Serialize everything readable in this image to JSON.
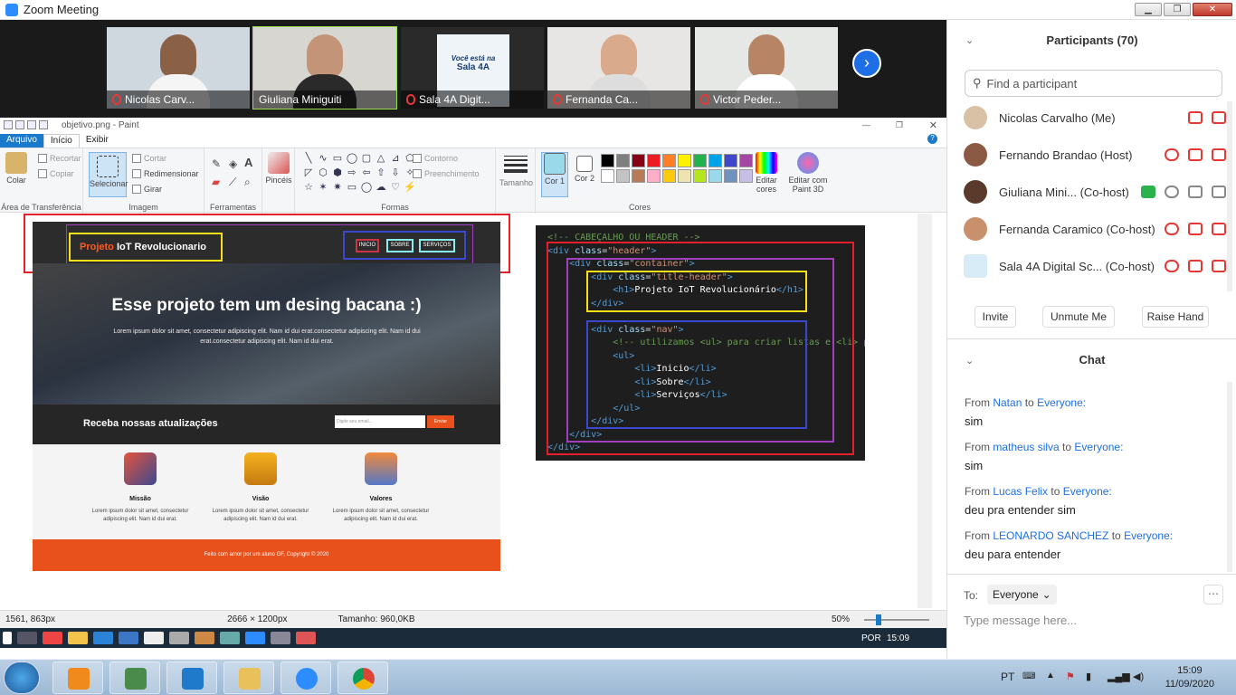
{
  "window": {
    "title": "Zoom Meeting"
  },
  "gallery": {
    "tiles": [
      {
        "name": "Nicolas Carv...",
        "muted": true
      },
      {
        "name": "Giuliana Miniguiti",
        "muted": false
      },
      {
        "name": "Sala 4A Digit...",
        "muted": true,
        "banner_line1": "Você está na",
        "banner_line2": "Sala 4A"
      },
      {
        "name": "Fernanda Ca...",
        "muted": true
      },
      {
        "name": "Victor Peder...",
        "muted": true
      }
    ]
  },
  "paint": {
    "title": "objetivo.png - Paint",
    "tabs": [
      "Arquivo",
      "Início",
      "Exibir"
    ],
    "ribbon": {
      "clipboard": {
        "paste": "Colar",
        "cut": "Recortar",
        "copy": "Copiar",
        "label": "Área de Transferência"
      },
      "image": {
        "select": "Selecionar",
        "crop": "Cortar",
        "resize": "Redimensionar",
        "rotate": "Girar",
        "label": "Imagem"
      },
      "tools": {
        "label": "Ferramentas"
      },
      "brushes": "Pincéis",
      "shapes": {
        "outline": "Contorno",
        "fill": "Preenchimento",
        "label": "Formas"
      },
      "size": "Tamanho",
      "color1": "Cor 1",
      "color2": "Cor 2",
      "edit_colors": "Editar cores",
      "paint3d": "Editar com Paint 3D",
      "colors_label": "Cores"
    },
    "palette": [
      "#000000",
      "#7f7f7f",
      "#880015",
      "#ed1c24",
      "#ff7f27",
      "#fff200",
      "#22b14c",
      "#00a2e8",
      "#3f48cc",
      "#a349a4",
      "#ffffff",
      "#c3c3c3",
      "#b97a57",
      "#ffaec9",
      "#ffc90e",
      "#efe4b0",
      "#b5e61d",
      "#99d9ea",
      "#7092be",
      "#c8bfe7"
    ],
    "status": {
      "cursor": "1561, 863px",
      "dimensions": "2666 × 1200px",
      "size": "Tamanho: 960,0KB",
      "zoom": "50%"
    }
  },
  "site": {
    "brand_highlight": "Projeto",
    "brand_rest": " IoT Revolucionario",
    "nav": [
      "INICIO",
      "SOBRE",
      "SERVIÇOS"
    ],
    "hero_title": "Esse projeto tem um desing bacana :)",
    "hero_text": "Lorem ipsum dolor sit amet, consectetur adipiscing elit. Nam id dui erat.consectetur adipiscing elit. Nam id dui erat.consectetur adipiscing elit. Nam id dui erat.",
    "news_title": "Receba nossas atualizações",
    "news_placeholder": "Digite seu email...",
    "news_button": "Enviar",
    "features": [
      {
        "title": "Missão",
        "text": "Lorem ipsum dolor sit amet, consectetur adipiscing elit. Nam id dui erat."
      },
      {
        "title": "Visão",
        "text": "Lorem ipsum dolor sit amet, consectetur adipiscing elit. Nam id dui erat."
      },
      {
        "title": "Valores",
        "text": "Lorem ipsum dolor sit amet, consectetur adipiscing elit. Nam id dui erat."
      }
    ],
    "footer": "Feito com amor por um aluno GF, Copyright © 2020"
  },
  "code": {
    "l1": "<!-- CABEÇALHO OU HEADER -->",
    "l2a": "<div ",
    "l2b": "class",
    "l2c": "=",
    "l2d": "\"header\"",
    "l2e": ">",
    "l3a": "<div ",
    "l3b": "class",
    "l3c": "=",
    "l3d": "\"container\"",
    "l3e": ">",
    "l4a": "<div ",
    "l4b": "class",
    "l4c": "=",
    "l4d": "\"title-header\"",
    "l4e": ">",
    "l5a": "<h1>",
    "l5b": "Projeto IoT Revolucionário",
    "l5c": "</h1>",
    "l6": "</div>",
    "l7a": "<div ",
    "l7b": "class",
    "l7c": "=",
    "l7d": "\"nav\"",
    "l7e": ">",
    "l8": "<!-- utilizamos <ul> para criar listas e <li> pa",
    "l9": "<ul>",
    "l10a": "<li>",
    "l10b": "Inicio",
    "l10c": "</li>",
    "l11a": "<li>",
    "l11b": "Sobre",
    "l11c": "</li>",
    "l12a": "<li>",
    "l12b": "Serviços",
    "l12c": "</li>",
    "l13": "</ul>",
    "l14": "</div>",
    "l15": "</div>",
    "l16": "</div>"
  },
  "remote_taskbar": {
    "lang": "POR",
    "time": "15:09"
  },
  "participants": {
    "title": "Participants (70)",
    "search_placeholder": "Find a participant",
    "list": [
      {
        "name": "Nicolas Carvalho (Me)"
      },
      {
        "name": "Fernando Brandao (Host)"
      },
      {
        "name": "Giuliana Mini...   (Co-host)"
      },
      {
        "name": "Fernanda Caramico (Co-host)"
      },
      {
        "name": "Sala 4A Digital Sc...  (Co-host)"
      }
    ],
    "buttons": {
      "invite": "Invite",
      "unmute": "Unmute Me",
      "raise": "Raise Hand"
    }
  },
  "chat": {
    "title": "Chat",
    "messages": [
      {
        "from": "Natan",
        "to": "Everyone:",
        "text": "sim"
      },
      {
        "from": "matheus silva",
        "to": "Everyone:",
        "text": "sim"
      },
      {
        "from": "Lucas Felix",
        "to": "Everyone:",
        "text": "deu pra entender sim"
      },
      {
        "from": "LEONARDO SANCHEZ",
        "to": "Everyone:",
        "text": "deu para entender"
      }
    ],
    "from_word": "From ",
    "to_word": " to ",
    "to_label": "To:",
    "recipient": "Everyone",
    "input_placeholder": "Type message here..."
  },
  "system_tray": {
    "lang": "PT",
    "time": "15:09",
    "date": "11/09/2020"
  }
}
